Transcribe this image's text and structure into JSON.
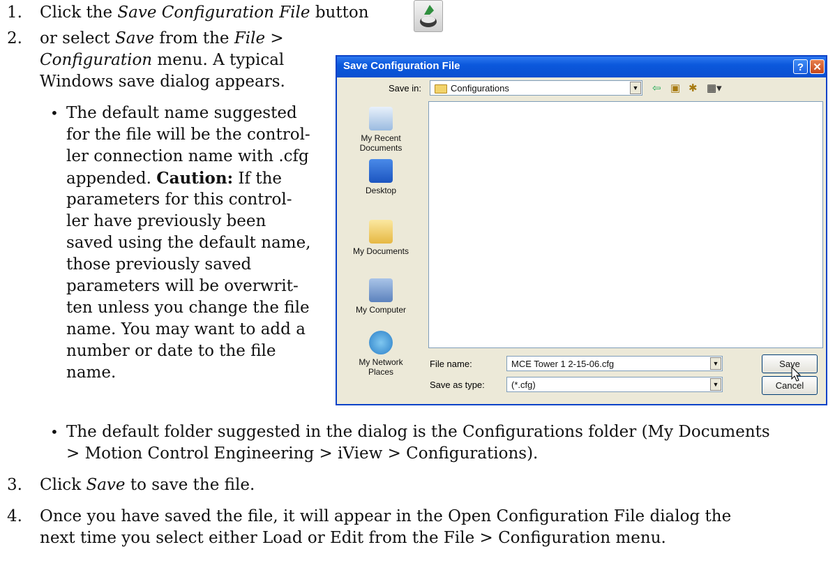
{
  "steps": {
    "s1": {
      "num": "1.",
      "pre": "Click the ",
      "em": "Save Configuration File",
      "post": " button"
    },
    "s2": {
      "num": "2.",
      "l1_pre": "or select ",
      "l1_em": "Save",
      "l1_mid": " from the ",
      "l1_em2": "File",
      "l1_post": " >",
      "l2_em": "Configuration",
      "l2_post": " menu. A typical",
      "l3": "Windows save dialog appears."
    },
    "bullet1": [
      "The default name suggested",
      "for the file will be the control-",
      "ler connection name with .cfg"
    ],
    "bullet1_caution_pre": "appended. ",
    "bullet1_caution_bold": "Caution:",
    "bullet1_caution_post": " If the",
    "bullet1_rest": [
      "parameters for this control-",
      "ler have previously been",
      "saved using the default name,",
      "those previously saved",
      "parameters will be overwrit-",
      "ten unless you change the file",
      "name. You may want to add a",
      "number or date to the file",
      "name."
    ],
    "bullet2": [
      "The default folder suggested in the dialog is the Configurations folder (My Documents",
      "> Motion Control Engineering > iView > Configurations)."
    ],
    "s3": {
      "num": "3.",
      "pre": "Click ",
      "em": "Save",
      "post": " to save the file."
    },
    "s4": {
      "num": "4.",
      "l1": "Once you have saved the file, it will appear in the Open Configuration File dialog the",
      "l2": "next time you select either Load or Edit from the File > Configuration menu."
    },
    "bullet_glyph": "•"
  },
  "dialog": {
    "title": "Save Configuration File",
    "help_glyph": "?",
    "close_glyph": "✕",
    "save_in_label": "Save in:",
    "save_in_value": "Configurations",
    "nav_icons": [
      "back-arrow-icon",
      "up-folder-icon",
      "new-folder-icon",
      "view-menu-icon"
    ],
    "nav_glyphs": [
      "⇦",
      "▣",
      "✱",
      "▦▾"
    ],
    "places": [
      "My Recent Documents",
      "Desktop",
      "My Documents",
      "My Computer",
      "My Network Places"
    ],
    "place_lines": [
      [
        "My Recent",
        "Documents"
      ],
      [
        "Desktop"
      ],
      [
        "My Documents"
      ],
      [
        "My Computer"
      ],
      [
        "My Network",
        "Places"
      ]
    ],
    "file_name_label": "File name:",
    "file_name_value": "MCE Tower 1 2-15-06.cfg",
    "save_type_label": "Save as type:",
    "save_type_value": "(*.cfg)",
    "save_button": "Save",
    "cancel_button": "Cancel",
    "dropdown_glyph": "▼"
  },
  "colors": {
    "title_blue": "#0a4fd0",
    "dialog_bg": "#ece9d8"
  }
}
